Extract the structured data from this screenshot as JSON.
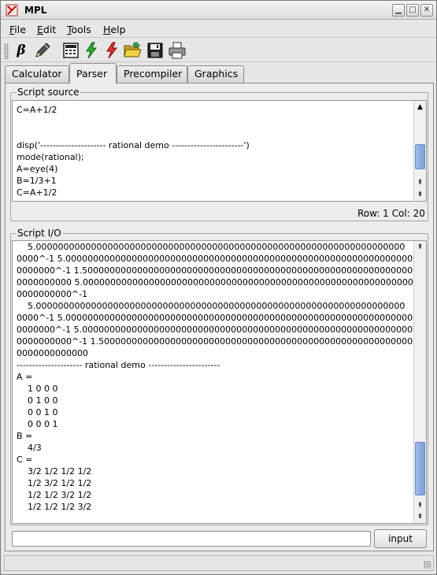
{
  "window": {
    "title": "MPL"
  },
  "window_controls": {
    "minimize": "▁",
    "maximize": "□",
    "close": "✕"
  },
  "menu": [
    {
      "underline": "F",
      "rest": "ile"
    },
    {
      "underline": "E",
      "rest": "dit"
    },
    {
      "underline": "T",
      "rest": "ools"
    },
    {
      "underline": "H",
      "rest": "elp"
    }
  ],
  "toolbar": {
    "beta_glyph": "β",
    "icons": [
      "beta-icon",
      "pencil-icon",
      "calculator-icon",
      "lightning-green-icon",
      "lightning-red-icon",
      "open-folder-icon",
      "save-disk-icon",
      "printer-icon"
    ]
  },
  "tabs": [
    "Calculator",
    "Parser",
    "Precompiler",
    "Graphics"
  ],
  "active_tab": "Parser",
  "script_source": {
    "title": "Script source",
    "lines": [
      "C=A+1/2",
      "",
      "",
      "disp('--------------------- rational demo -----------------------')",
      "mode(rational);",
      "A=eye(4)",
      "B=1/3+1",
      "C=A+1/2"
    ],
    "row_label": "Row:",
    "row": "1",
    "col_label": "Col:",
    "col": "20"
  },
  "script_io": {
    "title": "Script I/O",
    "lines": [
      "    5.0000000000000000000000000000000000000000000000000000000000000000000",
      "0000^-1 5.00000000000000000000000000000000000000000000000000000000000000000",
      "0000000^-1 1.500000000000000000000000000000000000000000000000000000000000000",
      "0000000000 5.000000000000000000000000000000000000000000000000000000000000000",
      "0000000000^-1",
      "    5.0000000000000000000000000000000000000000000000000000000000000000000",
      "0000^-1 5.00000000000000000000000000000000000000000000000000000000000000000",
      "0000000^-1 5.000000000000000000000000000000000000000000000000000000000000000",
      "0000000000^-1 1.500000000000000000000000000000000000000000000000000000000000",
      "0000000000000",
      "--------------------- rational demo -----------------------",
      "A =",
      "    1 0 0 0",
      "    0 1 0 0",
      "    0 0 1 0",
      "    0 0 0 1",
      "B =",
      "    4/3",
      "C =",
      "    3/2 1/2 1/2 1/2",
      "    1/2 3/2 1/2 1/2",
      "    1/2 1/2 3/2 1/2",
      "    1/2 1/2 1/2 3/2"
    ]
  },
  "input": {
    "value": "",
    "button_label": "input"
  },
  "scroll_arrows": {
    "up": "▲",
    "down": "▼",
    "up_fast": "⇞",
    "down_fast": "⇟"
  }
}
